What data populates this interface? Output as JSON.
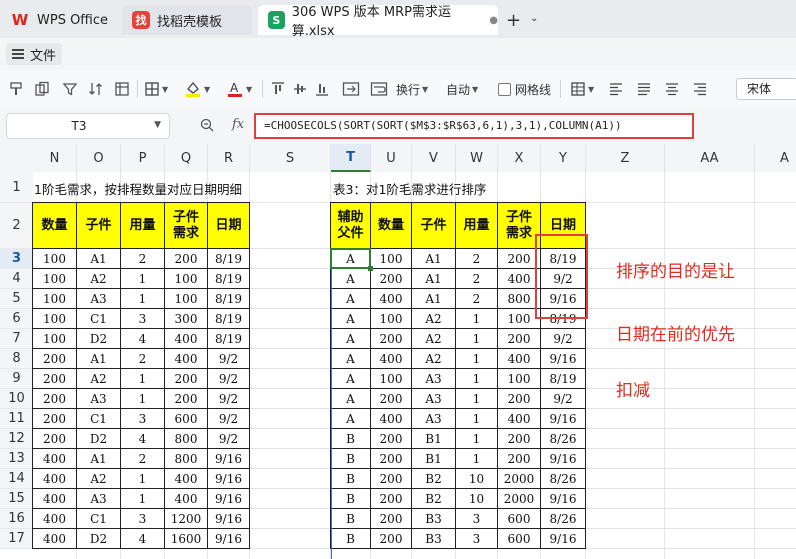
{
  "tabs": {
    "home": "WPS Office",
    "template": "找稻壳模板",
    "file": "306 WPS 版本 MRP需求运算.xlsx"
  },
  "menu": {
    "file_label": "文件"
  },
  "toolbar": {
    "wrap_label": "换行",
    "auto_label": "自动",
    "gridlines_label": "网格线",
    "font_name": "宋体",
    "icons": [
      "format-painter-icon",
      "copy-icon",
      "filter-icon",
      "sort-icon",
      "freeze-icon",
      "border-icon",
      "fill-color-icon",
      "font-color-icon",
      "merge-icon",
      "wrap-text-icon",
      "conditional-format-icon",
      "align-icon"
    ]
  },
  "formula_bar": {
    "cell_ref": "T3",
    "fx": "fx",
    "formula": "=CHOOSECOLS(SORT(SORT($M$3:$R$63,6,1),3,1),COLUMN(A1))"
  },
  "grid": {
    "columns": [
      "N",
      "O",
      "P",
      "Q",
      "R",
      "S",
      "T",
      "U",
      "V",
      "W",
      "X",
      "Y",
      "Z",
      "AA",
      "A"
    ],
    "rows": [
      "1",
      "2",
      "3",
      "4",
      "5",
      "6",
      "7",
      "8",
      "9",
      "10",
      "11",
      "12",
      "13",
      "14",
      "15",
      "16",
      "17"
    ],
    "selected_column": "T",
    "selected_row": "3"
  },
  "table1": {
    "title": "1阶毛需求，按排程数量对应日期明细",
    "headers": [
      "数量",
      "子件",
      "用量",
      "子件需求",
      "日期"
    ],
    "rows": [
      [
        "100",
        "A1",
        "2",
        "200",
        "8/19"
      ],
      [
        "100",
        "A2",
        "1",
        "100",
        "8/19"
      ],
      [
        "100",
        "A3",
        "1",
        "100",
        "8/19"
      ],
      [
        "100",
        "C1",
        "3",
        "300",
        "8/19"
      ],
      [
        "100",
        "D2",
        "4",
        "400",
        "8/19"
      ],
      [
        "200",
        "A1",
        "2",
        "400",
        "9/2"
      ],
      [
        "200",
        "A2",
        "1",
        "200",
        "9/2"
      ],
      [
        "200",
        "A3",
        "1",
        "200",
        "9/2"
      ],
      [
        "200",
        "C1",
        "3",
        "600",
        "9/2"
      ],
      [
        "200",
        "D2",
        "4",
        "800",
        "9/2"
      ],
      [
        "400",
        "A1",
        "2",
        "800",
        "9/16"
      ],
      [
        "400",
        "A2",
        "1",
        "400",
        "9/16"
      ],
      [
        "400",
        "A3",
        "1",
        "400",
        "9/16"
      ],
      [
        "400",
        "C1",
        "3",
        "1200",
        "9/16"
      ],
      [
        "400",
        "D2",
        "4",
        "1600",
        "9/16"
      ]
    ]
  },
  "table3": {
    "title": "表3：对1阶毛需求进行排序",
    "headers": [
      "辅助父件",
      "数量",
      "子件",
      "用量",
      "子件需求",
      "日期"
    ],
    "rows": [
      [
        "A",
        "100",
        "A1",
        "2",
        "200",
        "8/19"
      ],
      [
        "A",
        "200",
        "A1",
        "2",
        "400",
        "9/2"
      ],
      [
        "A",
        "400",
        "A1",
        "2",
        "800",
        "9/16"
      ],
      [
        "A",
        "100",
        "A2",
        "1",
        "100",
        "8/19"
      ],
      [
        "A",
        "200",
        "A2",
        "1",
        "200",
        "9/2"
      ],
      [
        "A",
        "400",
        "A2",
        "1",
        "400",
        "9/16"
      ],
      [
        "A",
        "100",
        "A3",
        "1",
        "100",
        "8/19"
      ],
      [
        "A",
        "200",
        "A3",
        "1",
        "200",
        "9/2"
      ],
      [
        "A",
        "400",
        "A3",
        "1",
        "400",
        "9/16"
      ],
      [
        "B",
        "200",
        "B1",
        "1",
        "200",
        "8/26"
      ],
      [
        "B",
        "200",
        "B1",
        "1",
        "200",
        "9/16"
      ],
      [
        "B",
        "200",
        "B2",
        "10",
        "2000",
        "8/26"
      ],
      [
        "B",
        "200",
        "B2",
        "10",
        "2000",
        "9/16"
      ],
      [
        "B",
        "200",
        "B3",
        "3",
        "600",
        "8/26"
      ],
      [
        "B",
        "200",
        "B3",
        "3",
        "600",
        "9/16"
      ]
    ]
  },
  "annotation": {
    "line1": "排序的目的是让",
    "line2": "日期在前的优先",
    "line3": "扣减"
  },
  "colors": {
    "header_fill": "#ffff00",
    "highlight_border": "#e0403a",
    "annotation_text": "#e02b20",
    "active_cell": "#2e7d32"
  }
}
